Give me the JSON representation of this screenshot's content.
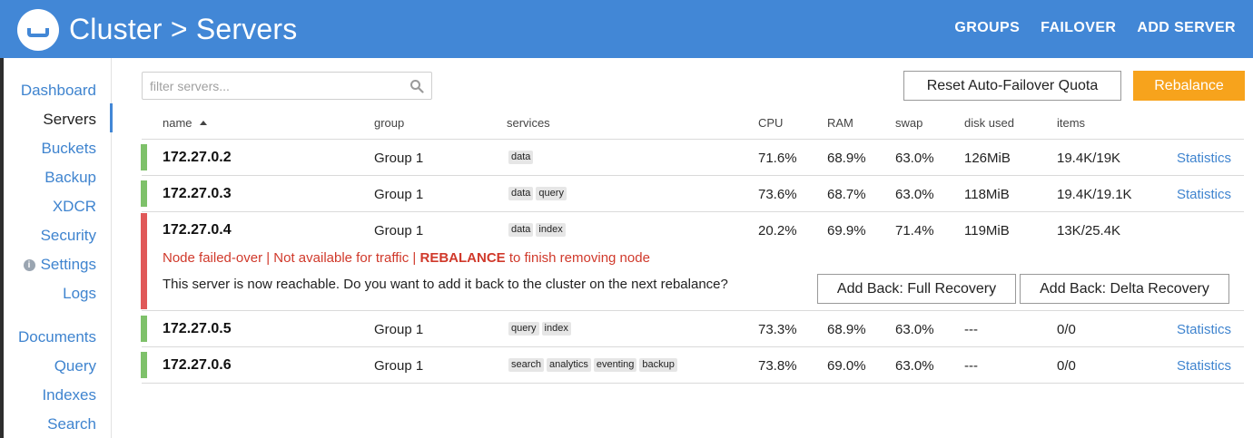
{
  "header": {
    "title": "Cluster > Servers",
    "links": [
      "GROUPS",
      "FAILOVER",
      "ADD SERVER"
    ]
  },
  "sidebar": {
    "items": [
      "Dashboard",
      "Servers",
      "Buckets",
      "Backup",
      "XDCR",
      "Security",
      "Settings",
      "Logs",
      "Documents",
      "Query",
      "Indexes",
      "Search"
    ],
    "active": "Servers"
  },
  "toolbar": {
    "filter_placeholder": "filter servers...",
    "filter_value": "",
    "reset_label": "Reset Auto-Failover Quota",
    "rebalance_label": "Rebalance"
  },
  "table": {
    "columns": [
      "name",
      "group",
      "services",
      "CPU",
      "RAM",
      "swap",
      "disk used",
      "items"
    ],
    "sorted_by": "name",
    "stats_label": "Statistics",
    "rows": [
      {
        "name": "172.27.0.2",
        "group": "Group 1",
        "services": [
          "data"
        ],
        "cpu": "71.6%",
        "ram": "68.9%",
        "swap": "63.0%",
        "disk": "126MiB",
        "items": "19.4K/19K",
        "status": "healthy"
      },
      {
        "name": "172.27.0.3",
        "group": "Group 1",
        "services": [
          "data",
          "query"
        ],
        "cpu": "73.6%",
        "ram": "68.7%",
        "swap": "63.0%",
        "disk": "118MiB",
        "items": "19.4K/19.1K",
        "status": "healthy"
      },
      {
        "name": "172.27.0.4",
        "group": "Group 1",
        "services": [
          "data",
          "index"
        ],
        "cpu": "20.2%",
        "ram": "69.9%",
        "swap": "71.4%",
        "disk": "119MiB",
        "items": "13K/25.4K",
        "status": "failed-over"
      },
      {
        "name": "172.27.0.5",
        "group": "Group 1",
        "services": [
          "query",
          "index"
        ],
        "cpu": "73.3%",
        "ram": "68.9%",
        "swap": "63.0%",
        "disk": "---",
        "items": "0/0",
        "status": "healthy"
      },
      {
        "name": "172.27.0.6",
        "group": "Group 1",
        "services": [
          "search",
          "analytics",
          "eventing",
          "backup"
        ],
        "cpu": "73.8%",
        "ram": "69.0%",
        "swap": "63.0%",
        "disk": "---",
        "items": "0/0",
        "status": "healthy"
      }
    ]
  },
  "failover_notice": {
    "status_prefix": "Node failed-over | Not available for traffic | ",
    "status_strong": "REBALANCE",
    "status_suffix": " to finish removing node",
    "reachable_text": "This server is now reachable. Do you want to add it back to the cluster on the next rebalance?",
    "full_recovery_label": "Add Back: Full Recovery",
    "delta_recovery_label": "Add Back: Delta Recovery"
  },
  "colors": {
    "header": "#4287d6",
    "link": "#3f84cf",
    "rebalance": "#f7a31c",
    "healthy": "#7ec16a",
    "failed": "#e05858",
    "error_text": "#d0392b"
  }
}
